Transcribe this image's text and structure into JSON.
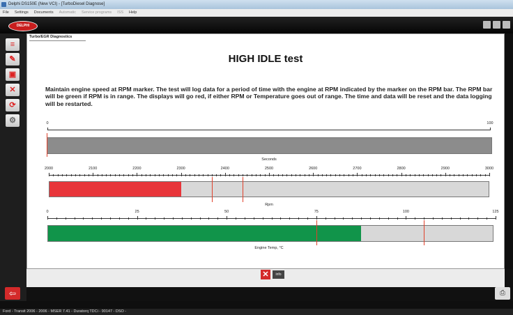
{
  "window": {
    "title": "Delphi DS150E (New VCI) - [TurboDiesel Diagnose]",
    "menu": [
      "File",
      "Settings",
      "Documents",
      "Automatic",
      "Service programs",
      "ISS",
      "Help"
    ]
  },
  "brand": {
    "logo_text": "DELPHI"
  },
  "panel": {
    "tab_label": "Turbo/EGR Diagnostics"
  },
  "test": {
    "title": "HIGH IDLE test",
    "instructions": "Maintain engine speed at RPM marker. The test will log data for a period of time with the engine at RPM indicated by the marker on the RPM bar. The RPM bar will be green if RPM is in range. The displays will go red, if either RPM or Temperature goes out of range. The time and data will be reset and the data logging will be restarted."
  },
  "gauges": {
    "time": {
      "caption": "Seconds",
      "min_label": "0",
      "max_label": "100",
      "min": 0,
      "max": 100,
      "value": 0,
      "fill_color": "#8c8c8c"
    },
    "rpm": {
      "caption": "Rpm",
      "tick_labels": [
        "2000",
        "2100",
        "2200",
        "2300",
        "2400",
        "2500",
        "2600",
        "2700",
        "2800",
        "2900",
        "3000"
      ],
      "min": 2000,
      "max": 3000,
      "value": 2300,
      "markers": [
        2370,
        2440
      ],
      "fill_color": "#e8353a",
      "bg_color": "#d8d8d8"
    },
    "temp": {
      "caption": "Engine Temp, °C",
      "tick_labels": [
        "0",
        "25",
        "50",
        "75",
        "100",
        "125"
      ],
      "min": 0,
      "max": 125,
      "value": 88,
      "markers": [
        75,
        105
      ],
      "fill_color": "#11944a",
      "bg_color": "#d8d8d8"
    }
  },
  "buttons": {
    "cancel_glyph": "✕",
    "info_label": "info",
    "back_glyph": "⇦",
    "print_glyph": "⎙"
  },
  "status": {
    "text": "Ford - Transit 2006 - 2006 - MSER 7.41 - Duratorq TDCi - 90147 - DSO -"
  }
}
